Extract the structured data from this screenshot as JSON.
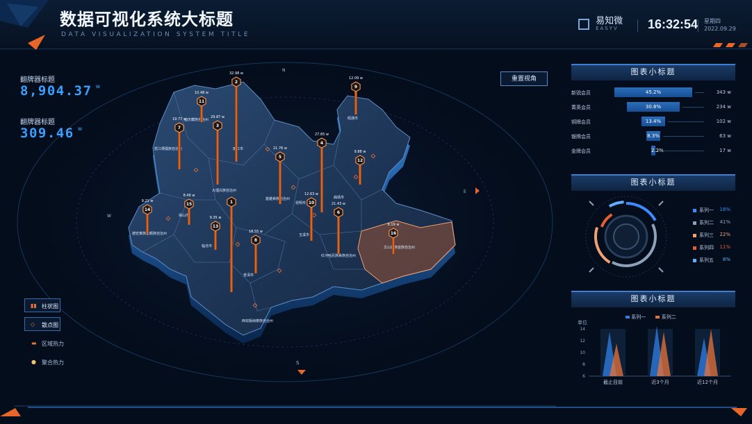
{
  "header": {
    "title": "数据可视化系统大标题",
    "subtitle": "DATA VISUALIZATION SYSTEM TITLE",
    "logo_cn": "易知微",
    "logo_en": "EASYV",
    "time": "16:32:54",
    "weekday": "星期四",
    "date": "2022.09.29"
  },
  "stats": [
    {
      "label": "翻牌器标题",
      "value": "8,904.37",
      "unit": "w"
    },
    {
      "label": "翻牌器标题",
      "value": "309.46",
      "unit": "w"
    }
  ],
  "reset_button": "重置视角",
  "compass": {
    "n": "N",
    "s": "S",
    "e": "E",
    "w": "W"
  },
  "map_legend": [
    {
      "label": "柱状图",
      "icon": "bar-chart-icon"
    },
    {
      "label": "散点图",
      "icon": "scatter-diamond-icon"
    },
    {
      "label": "区域热力",
      "icon": "area-heat-icon"
    },
    {
      "label": "聚合热力",
      "icon": "cluster-heat-icon"
    }
  ],
  "map_regions": [
    "怒江傈僳族自治州",
    "迪庆藏族自治州",
    "丽江市",
    "大理白族自治州",
    "保山市",
    "临沧市",
    "普洱市",
    "德宏傣族景颇族自治州",
    "楚雄彝族自治州",
    "昆明市",
    "曲靖市",
    "玉溪市",
    "红河哈尼族彝族自治州",
    "文山壮族苗族自治州",
    "西双版纳傣族自治州",
    "昭通市"
  ],
  "map_pins": [
    {
      "num": "1",
      "value": "",
      "colour": "#e8772e"
    },
    {
      "num": "2",
      "value": "32.98 w"
    },
    {
      "num": "3",
      "value": "29.87 w"
    },
    {
      "num": "4",
      "value": "27.65 w"
    },
    {
      "num": "5",
      "value": "21.76 w"
    },
    {
      "num": "6",
      "value": "21.43 w"
    },
    {
      "num": "7",
      "value": "19.77 w"
    },
    {
      "num": "8",
      "value": "18.55 w"
    },
    {
      "num": "9",
      "value": "12.09 w"
    },
    {
      "num": "10",
      "value": "12.63 w"
    },
    {
      "num": "11",
      "value": "10.48 w"
    },
    {
      "num": "12",
      "value": "9.88 w"
    },
    {
      "num": "13",
      "value": "9.35 w"
    },
    {
      "num": "14",
      "value": "9.21 w"
    },
    {
      "num": "15",
      "value": "8.49 w"
    },
    {
      "num": "16",
      "value": "8.19 w"
    }
  ],
  "panel1": {
    "title": "图表小标题",
    "rows": [
      {
        "label": "新锐会员",
        "pct": "45.2%",
        "value": "343",
        "unit": "w",
        "fraction": 0.452
      },
      {
        "label": "菁英会员",
        "pct": "30.8%",
        "value": "234",
        "unit": "w",
        "fraction": 0.308
      },
      {
        "label": "铜牌会员",
        "pct": "13.4%",
        "value": "102",
        "unit": "w",
        "fraction": 0.134
      },
      {
        "label": "银牌会员",
        "pct": "8.3%",
        "value": "63",
        "unit": "w",
        "fraction": 0.083
      },
      {
        "label": "金牌会员",
        "pct": "2.2%",
        "value": "17",
        "unit": "w",
        "fraction": 0.022
      }
    ]
  },
  "panel2": {
    "title": "图表小标题",
    "items": [
      {
        "name": "系列一",
        "pct": "18%",
        "colour": "#3c8bff",
        "value": 18
      },
      {
        "name": "系列二",
        "pct": "41%",
        "colour": "#8fa1b8",
        "value": 41
      },
      {
        "name": "系列三",
        "pct": "22%",
        "colour": "#f0a072",
        "value": 22
      },
      {
        "name": "系列四",
        "pct": "11%",
        "colour": "#e2602f",
        "value": 11
      },
      {
        "name": "系列五",
        "pct": "8%",
        "colour": "#5fb0ff",
        "value": 8
      }
    ]
  },
  "panel3": {
    "title": "图表小标题",
    "unit_label": "单位",
    "legend": [
      "系列一",
      "系列二"
    ],
    "colours": [
      "#2f7fe6",
      "#e8733a"
    ]
  },
  "chart_data": {
    "type": "area",
    "categories": [
      "截止目前",
      "近3个月",
      "近12个月"
    ],
    "series": [
      {
        "name": "系列一",
        "values": [
          13.5,
          14.5,
          12.5
        ]
      },
      {
        "name": "系列二",
        "values": [
          11.5,
          13.5,
          14
        ]
      }
    ],
    "ylim": [
      6,
      14
    ],
    "yticks": [
      6,
      8,
      10,
      12,
      14
    ],
    "ylabel": "单位"
  }
}
